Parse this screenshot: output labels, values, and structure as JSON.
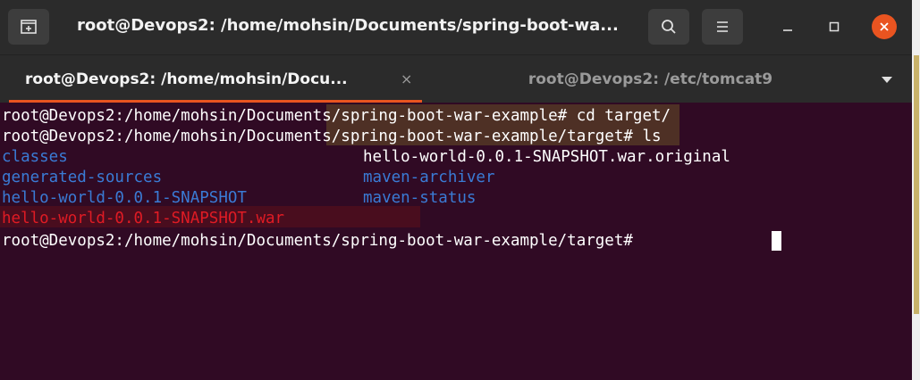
{
  "window": {
    "title": "root@Devops2: /home/mohsin/Documents/spring-boot-wa...",
    "icons": {
      "new_tab": "new-tab-icon",
      "search": "search-icon",
      "menu": "hamburger-menu-icon",
      "minimize": "minimize-icon",
      "maximize": "maximize-icon",
      "close": "close-icon"
    },
    "accent_color": "#e95420",
    "background": "#300a24"
  },
  "tabs": [
    {
      "label": "root@Devops2: /home/mohsin/Docu...",
      "active": true,
      "close_glyph": "×"
    },
    {
      "label": "root@Devops2: /etc/tomcat9",
      "active": false
    }
  ],
  "terminal": {
    "lines": [
      {
        "text": "root@Devops2:/home/mohsin/Documents/spring-boot-war-example# cd target/"
      },
      {
        "text": "root@Devops2:/home/mohsin/Documents/spring-boot-war-example/target# ls"
      },
      {
        "col1": "classes",
        "col2": "hello-world-0.0.1-SNAPSHOT.war.original"
      },
      {
        "col1": "generated-sources",
        "col2": "maven-archiver"
      },
      {
        "col1": "hello-world-0.0.1-SNAPSHOT",
        "col2": "maven-status"
      },
      {
        "col1": "hello-world-0.0.1-SNAPSHOT.war"
      },
      {
        "text": "root@Devops2:/home/mohsin/Documents/spring-boot-war-example/target# "
      }
    ],
    "colors": {
      "directory": "#3a7bd5",
      "archive": "#e01b24",
      "text": "#ffffff"
    }
  }
}
